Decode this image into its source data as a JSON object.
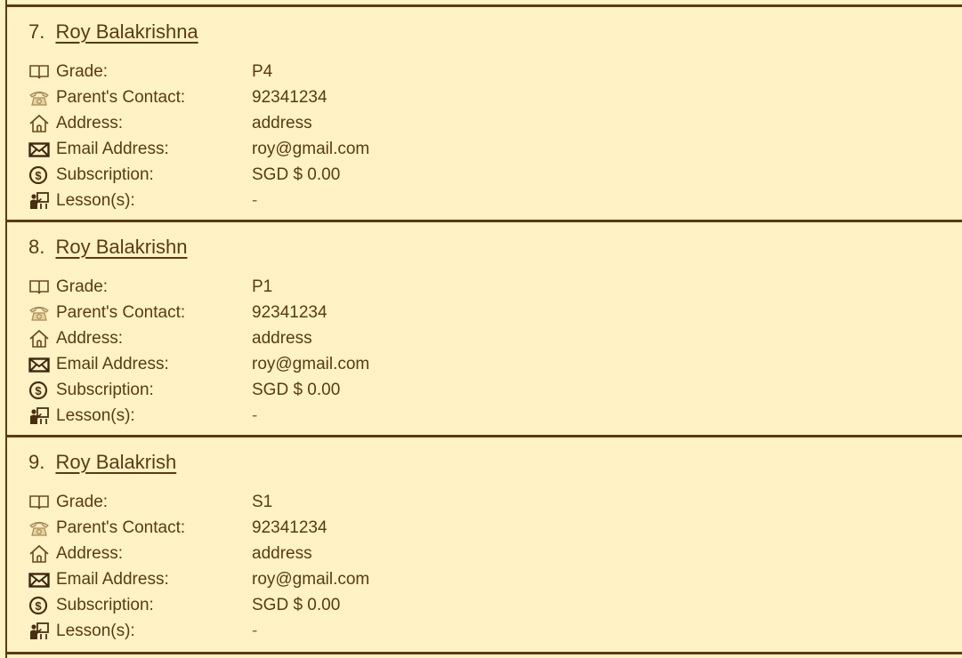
{
  "fields": {
    "grade_label": "Grade:",
    "contact_label": "Parent's Contact:",
    "address_label": "Address:",
    "email_label": "Email Address:",
    "subscription_label": "Subscription:",
    "lessons_label": "Lesson(s):"
  },
  "icons": {
    "grade": "book-icon",
    "contact": "telephone-icon",
    "address": "house-icon",
    "email": "envelope-icon",
    "subscription": "dollar-coin-icon",
    "lessons": "teacher-icon"
  },
  "colors": {
    "background": "#fff2c4",
    "border": "#5c3a14",
    "text": "#5a3a14"
  },
  "students": [
    {
      "index": "7.",
      "name": "Roy Balakrishna",
      "grade": "P4",
      "contact": "92341234",
      "address": "address",
      "email": "roy@gmail.com",
      "subscription": "SGD $ 0.00",
      "lessons": "-"
    },
    {
      "index": "8.",
      "name": "Roy Balakrishn",
      "grade": "P1",
      "contact": "92341234",
      "address": "address",
      "email": "roy@gmail.com",
      "subscription": "SGD $ 0.00",
      "lessons": "-"
    },
    {
      "index": "9.",
      "name": "Roy Balakrish",
      "grade": "S1",
      "contact": "92341234",
      "address": "address",
      "email": "roy@gmail.com",
      "subscription": "SGD $ 0.00",
      "lessons": "-"
    }
  ]
}
